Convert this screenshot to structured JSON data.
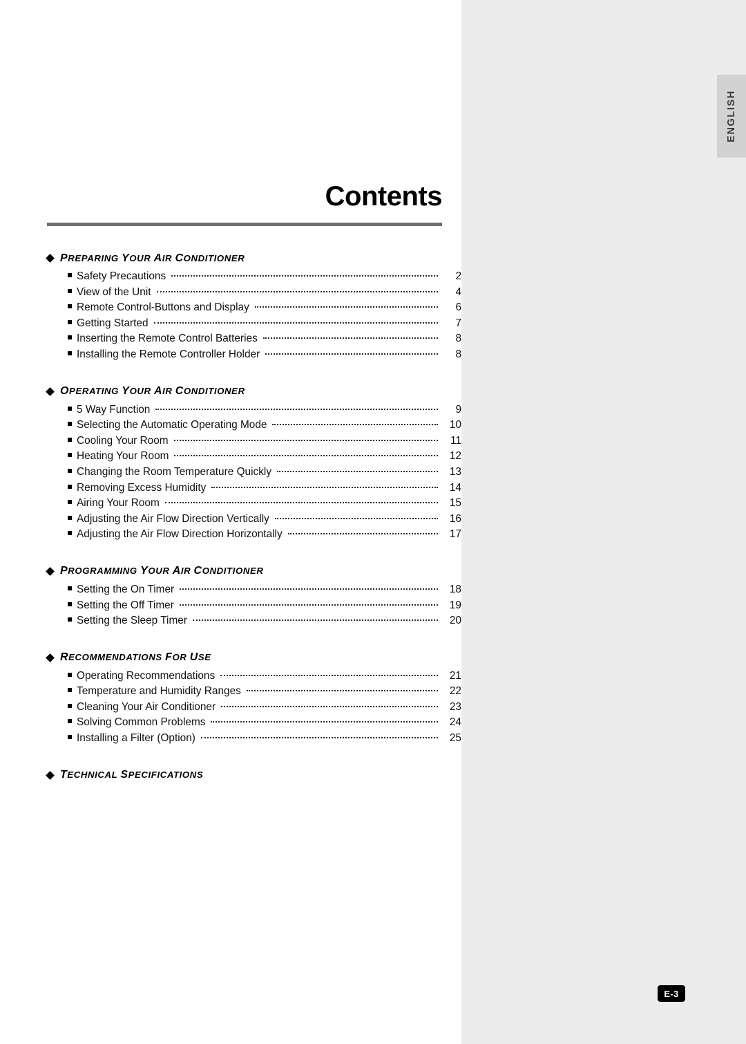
{
  "title": "Contents",
  "side_tab": {
    "label": "ENGLISH"
  },
  "page_badge": {
    "label": "E-3"
  },
  "sections": [
    {
      "id": "preparing",
      "title": "PREPARING YOUR AIR CONDITIONER",
      "entries": [
        {
          "label": "Safety Precautions",
          "page": "2"
        },
        {
          "label": "View of the Unit",
          "page": "4"
        },
        {
          "label": "Remote Control-Buttons and Display",
          "page": "6"
        },
        {
          "label": "Getting Started",
          "page": "7"
        },
        {
          "label": "Inserting the Remote Control Batteries",
          "page": "8"
        },
        {
          "label": "Installing the Remote Controller Holder",
          "page": "8"
        }
      ]
    },
    {
      "id": "operating",
      "title": "OPERATING YOUR AIR CONDITIONER",
      "entries": [
        {
          "label": "5 Way Function",
          "page": "9"
        },
        {
          "label": "Selecting the Automatic Operating Mode",
          "page": "10"
        },
        {
          "label": "Cooling Your Room",
          "page": "11"
        },
        {
          "label": "Heating Your Room",
          "page": "12"
        },
        {
          "label": "Changing the Room Temperature Quickly",
          "page": "13"
        },
        {
          "label": "Removing Excess Humidity",
          "page": "14"
        },
        {
          "label": "Airing Your Room",
          "page": "15"
        },
        {
          "label": "Adjusting the Air Flow Direction Vertically",
          "page": "16"
        },
        {
          "label": "Adjusting the Air Flow Direction Horizontally",
          "page": "17"
        }
      ]
    },
    {
      "id": "programming",
      "title": "PROGRAMMING YOUR AIR CONDITIONER",
      "entries": [
        {
          "label": "Setting the On Timer",
          "page": "18"
        },
        {
          "label": "Setting the Off Timer",
          "page": "19"
        },
        {
          "label": "Setting the Sleep Timer",
          "page": "20"
        }
      ]
    },
    {
      "id": "recommendations",
      "title": "RECOMMENDATIONS FOR USE",
      "entries": [
        {
          "label": "Operating Recommendations",
          "page": "21"
        },
        {
          "label": "Temperature and Humidity Ranges",
          "page": "22"
        },
        {
          "label": "Cleaning Your Air Conditioner",
          "page": "23"
        },
        {
          "label": "Solving Common Problems",
          "page": "24"
        },
        {
          "label": "Installing a Filter (Option)",
          "page": "25"
        }
      ]
    },
    {
      "id": "technical",
      "title": "TECHNICAL SPECIFICATIONS",
      "entries": []
    }
  ]
}
